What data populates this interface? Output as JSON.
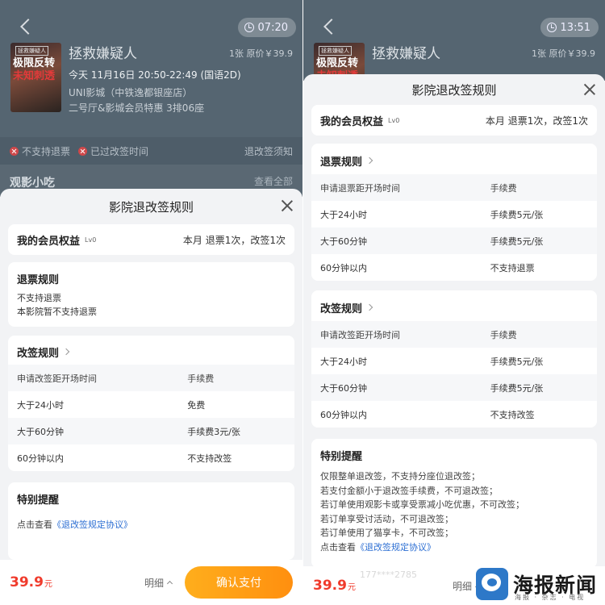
{
  "left": {
    "timer": "07:20",
    "movie": {
      "title": "拯救嫌疑人",
      "ticket_price": "1张 原价￥39.9",
      "show_time": "今天 11月16日 20:50-22:49 (国语2D)",
      "cinema": "UNI影城（中铁逸都银座店）",
      "hall_seat": "二号厅&影城会员特惠  3排06座",
      "poster_tag": "拯救嫌疑人",
      "poster_line1": "极限反转",
      "poster_line2": "未知刺透"
    },
    "status": {
      "no_refund": "不支持退票",
      "past_change": "已过改签时间",
      "notice_link": "退改签须知"
    },
    "snacks": {
      "title": "观影小吃",
      "view_all": "查看全部"
    },
    "sheet": {
      "title": "影院退改签规则",
      "member": {
        "title": "我的会员权益",
        "level": "Lv0",
        "info": "本月 退票1次，改签1次"
      },
      "refund": {
        "title": "退票规则",
        "lines": [
          "不支持退票",
          "本影院暂不支持退票"
        ]
      },
      "change": {
        "title": "改签规则",
        "header": [
          "申请改签距开场时间",
          "手续费"
        ],
        "rows": [
          [
            "大于24小时",
            "免费"
          ],
          [
            "大于60分钟",
            "手续费3元/张"
          ],
          [
            "60分钟以内",
            "不支持改签"
          ]
        ]
      },
      "special": {
        "title": "特别提醒",
        "prefix": "点击查看",
        "link": "《退改签规定协议》"
      }
    },
    "bottom": {
      "price": "39.9",
      "unit": "元",
      "detail": "明细",
      "pay": "确认支付"
    }
  },
  "right": {
    "timer": "13:51",
    "movie": {
      "title": "拯救嫌疑人",
      "ticket_price": "1张 原价￥39.9",
      "poster_tag": "拯救嫌疑人",
      "poster_line1": "极限反转",
      "poster_line2": "未知刺透"
    },
    "sheet": {
      "title": "影院退改签规则",
      "member": {
        "title": "我的会员权益",
        "level": "Lv0",
        "info": "本月 退票1次，改签1次"
      },
      "refund": {
        "title": "退票规则",
        "header": [
          "申请退票距开场时间",
          "手续费"
        ],
        "rows": [
          [
            "大于24小时",
            "手续费5元/张"
          ],
          [
            "大于60分钟",
            "手续费5元/张"
          ],
          [
            "60分钟以内",
            "不支持退票"
          ]
        ]
      },
      "change": {
        "title": "改签规则",
        "header": [
          "申请改签距开场时间",
          "手续费"
        ],
        "rows": [
          [
            "大于24小时",
            "手续费5元/张"
          ],
          [
            "大于60分钟",
            "手续费5元/张"
          ],
          [
            "60分钟以内",
            "不支持改签"
          ]
        ]
      },
      "special": {
        "title": "特别提醒",
        "lines": [
          "仅限整单退改签，不支持分座位退改签；",
          "若支付金额小于退改签手续费，不可退改签；",
          "若订单使用观影卡或享受票减小吃优惠，不可改签；",
          "若订单享受讨活动，不可退改签；",
          "若订单使用了猫享卡，不可改签；"
        ],
        "prefix": "点击查看",
        "link": "《退改签规定协议》"
      }
    },
    "bottom": {
      "price": "39.9",
      "unit": "元",
      "detail": "明细",
      "phone": "177****2785"
    }
  },
  "watermark": {
    "text": "海报新闻",
    "sub": "海报 · 杂志 · 电视"
  },
  "colors": {
    "price": "#f03b2c",
    "pay_button": "#ff9f14",
    "link": "#2d6fd3",
    "backdrop": "#556571"
  }
}
